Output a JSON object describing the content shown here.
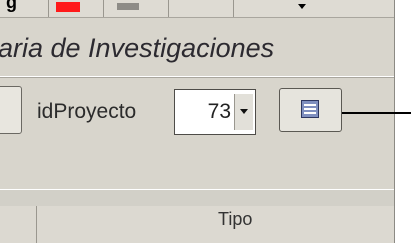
{
  "toolbar": {
    "partial_letter": "g",
    "swatch_color": "#ff1a1a",
    "dropdown_icon": "chevron-down-icon"
  },
  "form": {
    "title": "aria de Investigaciones",
    "id_label": "idProyecto",
    "id_value": "73",
    "open_form_icon": "form-icon"
  },
  "grid": {
    "column_header": "Tipo"
  }
}
